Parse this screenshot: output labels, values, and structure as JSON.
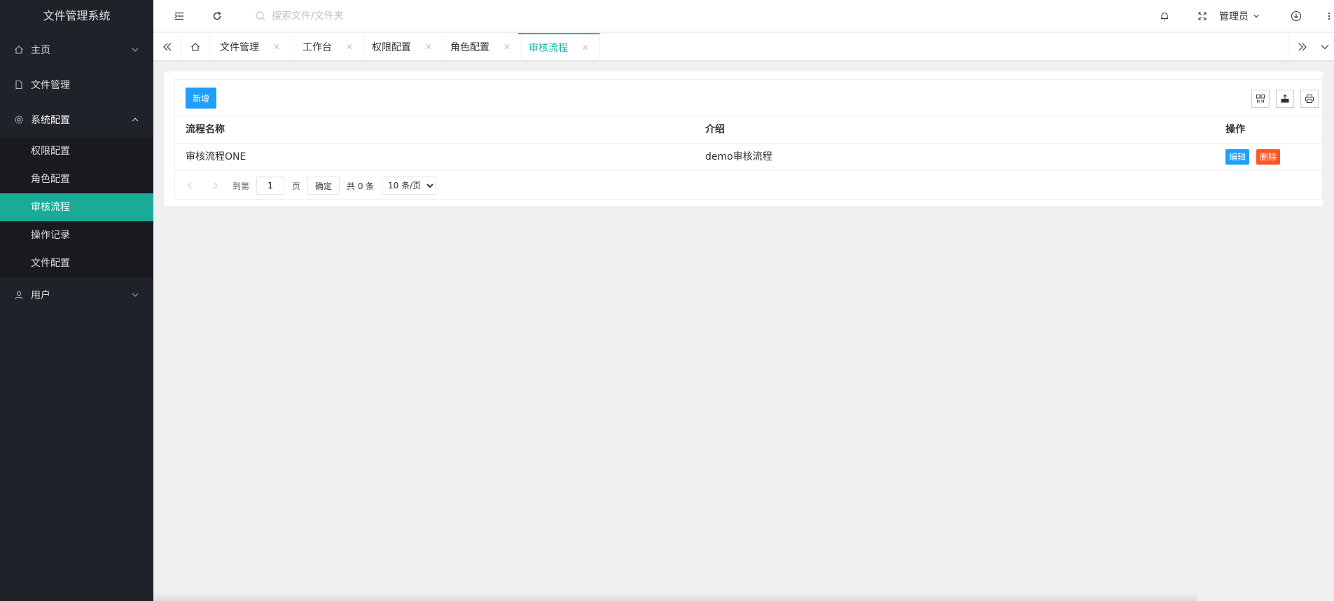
{
  "app": {
    "title": "文件管理系统"
  },
  "sidebar": {
    "items": [
      {
        "label": "主页",
        "icon": "home-icon"
      },
      {
        "label": "文件管理",
        "icon": "file-icon"
      },
      {
        "label": "系统配置",
        "icon": "gear-icon"
      },
      {
        "label": "用户",
        "icon": "user-icon"
      }
    ],
    "sub_items": [
      {
        "label": "权限配置"
      },
      {
        "label": "角色配置"
      },
      {
        "label": "审核流程",
        "active": true
      },
      {
        "label": "操作记录"
      },
      {
        "label": "文件配置"
      }
    ]
  },
  "header": {
    "search_placeholder": "搜索文件/文件夹",
    "user_label": "管理员"
  },
  "tabs": [
    {
      "label": "文件管理"
    },
    {
      "label": "工作台"
    },
    {
      "label": "权限配置"
    },
    {
      "label": "角色配置"
    },
    {
      "label": "审核流程",
      "active": true
    }
  ],
  "table": {
    "add_label": "新增",
    "columns": [
      "流程名称",
      "介绍",
      "操作"
    ],
    "rows": [
      {
        "name": "审核流程ONE",
        "desc": "demo审核流程"
      }
    ],
    "edit_label": "编辑",
    "delete_label": "删除"
  },
  "pager": {
    "goto_label": "到第",
    "page_value": "1",
    "page_unit": "页",
    "confirm_label": "确定",
    "total_label": "共 0 条",
    "size_option": "10 条/页"
  },
  "colors": {
    "sidebar_bg": "#20222a",
    "submenu_bg": "#181a1f",
    "accent": "#1aab98",
    "primary": "#1e9fff",
    "danger": "#ff5722"
  }
}
